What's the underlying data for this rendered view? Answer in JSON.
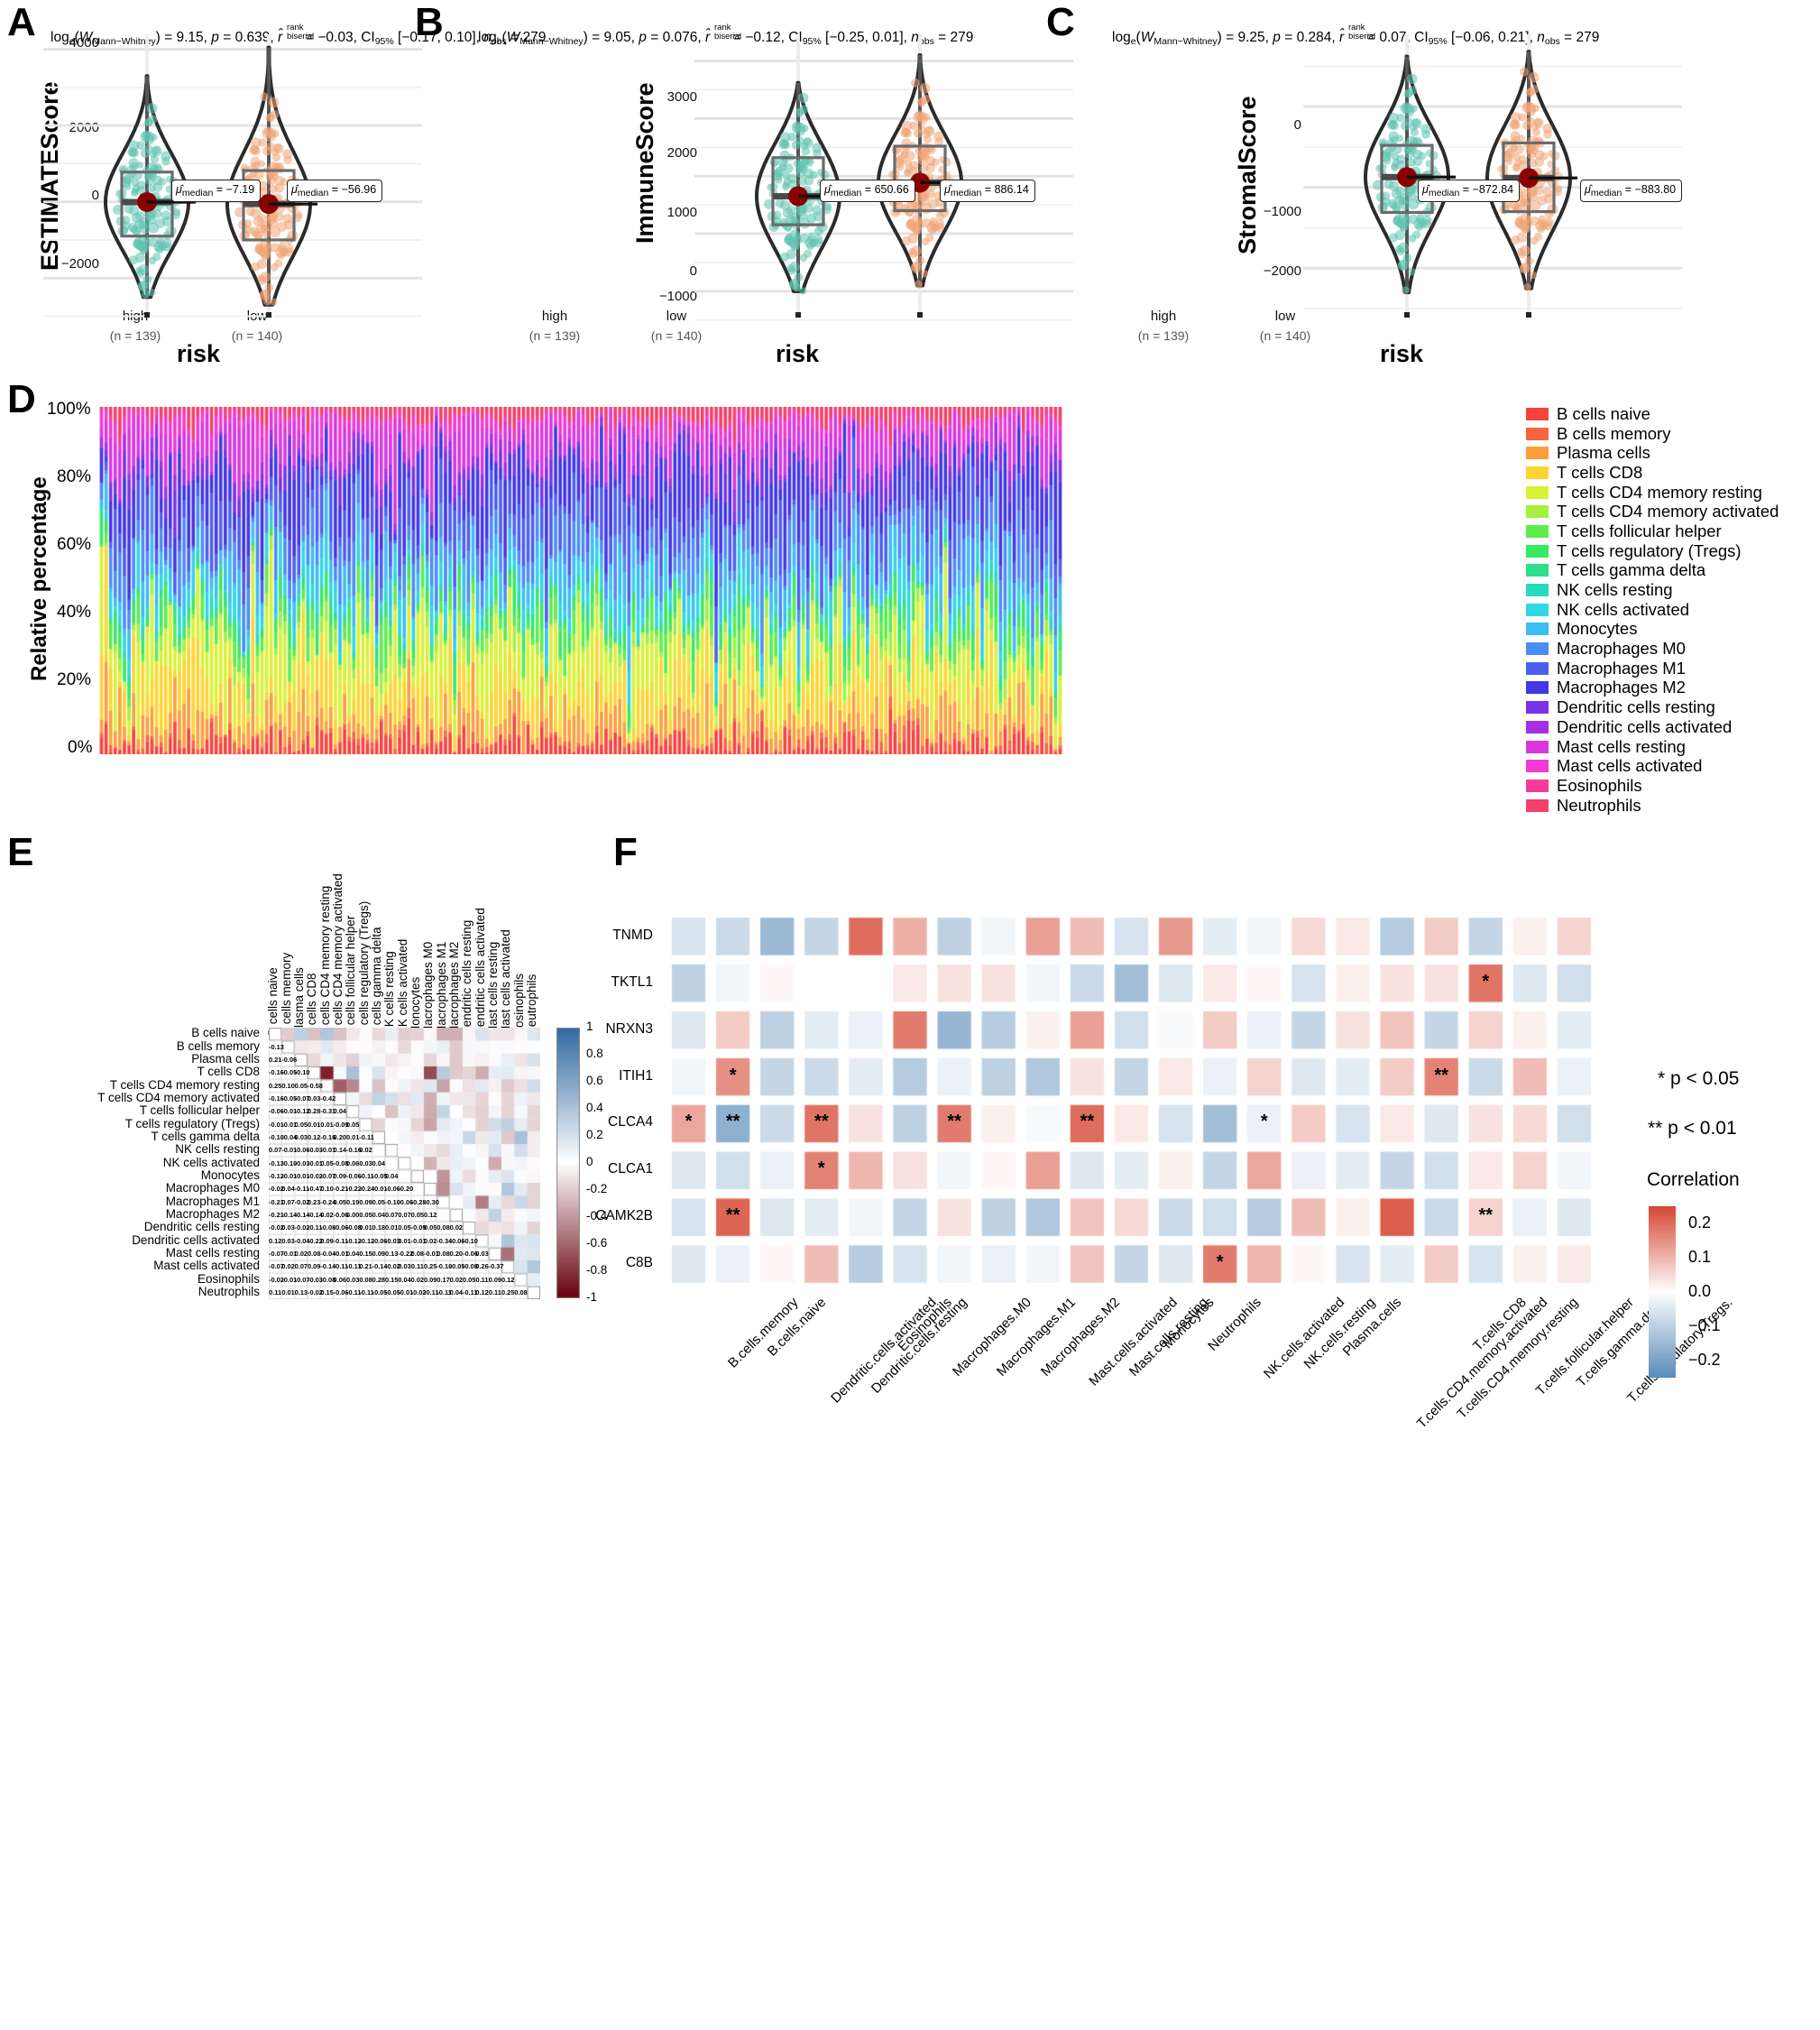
{
  "figure": {
    "panels": [
      "A",
      "B",
      "C",
      "D",
      "E",
      "F"
    ]
  },
  "panelA": {
    "letter": "A",
    "title_parts": {
      "logw": "log",
      "logw_sub": "e",
      "w": "W",
      "w_sub": "Mann−Whitney",
      "w_val": "= 9.15,",
      "p": "p",
      "p_val": "= 0.639,",
      "r_sup": "rank",
      "r_sub": "biserial",
      "r_val": "= −0.03,",
      "ci": "CI",
      "ci_sub": "95%",
      "ci_val": "[−0.17, 0.10],",
      "n": "n",
      "n_sub": "obs",
      "n_val": "= 279"
    },
    "ylabel": "ESTIMATEScore",
    "xlabel": "risk",
    "yticks": [
      "4000",
      "2000",
      "0",
      "−2000"
    ],
    "groups": [
      {
        "name": "high",
        "n": "(n = 139)",
        "median_label": "μ",
        "median_sub": "median",
        "median_val": "= −7.19"
      },
      {
        "name": "low",
        "n": "(n = 140)",
        "median_label": "μ",
        "median_sub": "median",
        "median_val": "= −56.96"
      }
    ]
  },
  "panelB": {
    "letter": "B",
    "title_parts": {
      "logw": "log",
      "logw_sub": "e",
      "w": "W",
      "w_sub": "Mann−Whitney",
      "w_val": "= 9.05,",
      "p": "p",
      "p_val": "= 0.076,",
      "r_sup": "rank",
      "r_sub": "biserial",
      "r_val": "= −0.12,",
      "ci": "CI",
      "ci_sub": "95%",
      "ci_val": "[−0.25, 0.01],",
      "n": "n",
      "n_sub": "obs",
      "n_val": "= 279"
    },
    "ylabel": "ImmuneScore",
    "xlabel": "risk",
    "yticks": [
      "3000",
      "2000",
      "1000",
      "0",
      "−1000"
    ],
    "groups": [
      {
        "name": "high",
        "n": "(n = 139)",
        "median_label": "μ",
        "median_sub": "median",
        "median_val": "= 650.66"
      },
      {
        "name": "low",
        "n": "(n = 140)",
        "median_label": "μ",
        "median_sub": "median",
        "median_val": "= 886.14"
      }
    ]
  },
  "panelC": {
    "letter": "C",
    "title_parts": {
      "logw": "log",
      "logw_sub": "e",
      "w": "W",
      "w_sub": "Mann−Whitney",
      "w_val": "= 9.25,",
      "p": "p",
      "p_val": "= 0.284,",
      "r_sup": "rank",
      "r_sub": "biserial",
      "r_val": "= 0.07,",
      "ci": "CI",
      "ci_sub": "95%",
      "ci_val": "[−0.06, 0.21],",
      "n": "n",
      "n_sub": "obs",
      "n_val": "= 279"
    },
    "ylabel": "StromalScore",
    "xlabel": "risk",
    "yticks": [
      "0",
      "−1000",
      "−2000"
    ],
    "groups": [
      {
        "name": "high",
        "n": "(n = 139)",
        "median_label": "μ",
        "median_sub": "median",
        "median_val": "= −872.84"
      },
      {
        "name": "low",
        "n": "(n = 140)",
        "median_label": "μ",
        "median_sub": "median",
        "median_val": "= −883.80"
      }
    ]
  },
  "panelD": {
    "letter": "D",
    "ylabel": "Relative percentage",
    "yticks": [
      "100%",
      "80%",
      "60%",
      "40%",
      "20%",
      "0%"
    ],
    "legend": [
      {
        "label": "B cells naive",
        "color": "#f8423c"
      },
      {
        "label": "B cells memory",
        "color": "#f9653f"
      },
      {
        "label": "Plasma cells",
        "color": "#fb9f3b"
      },
      {
        "label": "T cells CD8",
        "color": "#fdd431"
      },
      {
        "label": "T cells CD4 memory resting",
        "color": "#d9f135"
      },
      {
        "label": "T cells CD4 memory activated",
        "color": "#a3f03f"
      },
      {
        "label": "T cells follicular helper",
        "color": "#5ced4b"
      },
      {
        "label": "T cells regulatory (Tregs)",
        "color": "#39e95f"
      },
      {
        "label": "T cells gamma delta",
        "color": "#2de08b"
      },
      {
        "label": "NK cells resting",
        "color": "#27dbbd"
      },
      {
        "label": "NK cells activated",
        "color": "#2fd7e4"
      },
      {
        "label": "Monocytes",
        "color": "#3bbdf5"
      },
      {
        "label": "Macrophages M0",
        "color": "#4a8df5"
      },
      {
        "label": "Macrophages M1",
        "color": "#4c5ff0"
      },
      {
        "label": "Macrophages M2",
        "color": "#4236e6"
      },
      {
        "label": "Dendritic cells resting",
        "color": "#7a32e4"
      },
      {
        "label": "Dendritic cells activated",
        "color": "#a52fe2"
      },
      {
        "label": "Mast cells resting",
        "color": "#d936e0"
      },
      {
        "label": "Mast cells activated",
        "color": "#f23bd2"
      },
      {
        "label": "Eosinophils",
        "color": "#f63b9a"
      },
      {
        "label": "Neutrophils",
        "color": "#f4406a"
      }
    ]
  },
  "panelE": {
    "letter": "E",
    "labels": [
      "B cells naive",
      "B cells memory",
      "Plasma cells",
      "T cells CD8",
      "T cells CD4 memory resting",
      "T cells CD4 memory activated",
      "T cells follicular helper",
      "T cells regulatory (Tregs)",
      "T cells gamma delta",
      "NK cells resting",
      "NK cells activated",
      "Monocytes",
      "Macrophages M0",
      "Macrophages M1",
      "Macrophages M2",
      "Dendritic cells resting",
      "Dendritic cells activated",
      "Mast cells resting",
      "Mast cells activated",
      "Eosinophils",
      "Neutrophils"
    ],
    "scale_ticks": [
      "1",
      "0.8",
      "0.6",
      "0.4",
      "0.2",
      "0",
      "-0.2",
      "-0.4",
      "-0.6",
      "-0.8",
      "-1"
    ],
    "matrix": [
      [],
      [
        "-0.13"
      ],
      [
        "0.21",
        "-0.06"
      ],
      [
        "-0.16",
        "-0.05",
        "-0.10"
      ],
      [
        "0.25",
        "0.10",
        "0.05",
        "-0.58"
      ],
      [
        "-0.16",
        "-0.05",
        "-0.07",
        "0.03",
        "-0.42"
      ],
      [
        "-0.06",
        "-0.01",
        "-0.12",
        "0.28",
        "-0.31",
        "0.04"
      ],
      [
        "-0.01",
        "-0.01",
        "0.05",
        "0.01",
        "0.01",
        "-0.09",
        "0.05"
      ],
      [
        "-0.10",
        "-0.04",
        "0.03",
        "0.12",
        "-0.16",
        "0.20",
        "0.01",
        "-0.11"
      ],
      [
        "0.07",
        "-0.01",
        "-0.06",
        "-0.03",
        "-0.01",
        "0.14",
        "-0.16",
        "0.02"
      ],
      [
        "-0.13",
        "-0.10",
        "-0.03",
        "-0.01",
        "0.05",
        "-0.08",
        "0.06",
        "0.03",
        "0.04"
      ],
      [
        "-0.12",
        "-0.01",
        "-0.01",
        "-0.02",
        "-0.07",
        "0.09",
        "-0.06",
        "-0.11",
        "-0.05",
        "0.04"
      ],
      [
        "-0.02",
        "0.04",
        "-0.11",
        "-0.47",
        "0.10",
        "-0.21",
        "-0.22",
        "-0.24",
        "-0.01",
        "-0.06",
        "-0.20"
      ],
      [
        "-0.21",
        "0.07",
        "-0.02",
        "0.23",
        "-0.24",
        "0.05",
        "0.19",
        "0.09",
        "0.05",
        "-0.10",
        "-0.06",
        "-0.28",
        "-0.30"
      ],
      [
        "-0.21",
        "-0.14",
        "-0.14",
        "-0.14",
        "0.02",
        "-0.06",
        "0.00",
        "0.05",
        "0.04",
        "0.07",
        "0.07",
        "0.05",
        "0.12"
      ],
      [
        "-0.02",
        "0.03",
        "-0.02",
        "-0.11",
        "-0.08",
        "-0.06",
        "-0.08",
        "0.01",
        "0.18",
        "0.01",
        "0.05",
        "-0.09",
        "0.05",
        "0.08",
        "0.02"
      ],
      [
        "0.12",
        "0.03",
        "-0.04",
        "-0.22",
        "0.09",
        "-0.11",
        "-0.12",
        "-0.12",
        "-0.06",
        "-0.03",
        "0.01",
        "-0.01",
        "0.02",
        "-0.34",
        "-0.06",
        "-0.10"
      ],
      [
        "-0.07",
        "-0.01",
        "0.02",
        "0.08",
        "-0.04",
        "-0.01",
        "0.04",
        "0.15",
        "0.09",
        "0.13",
        "-0.22",
        "0.08",
        "-0.01",
        "0.08",
        "0.20",
        "-0.06",
        "0.03"
      ],
      [
        "-0.07",
        "0.02",
        "0.07",
        "0.09",
        "-0.14",
        "-0.11",
        "-0.11",
        "0.21",
        "-0.14",
        "-0.02",
        "0.03",
        "0.11",
        "0.25",
        "-0.10",
        "-0.05",
        "-0.08",
        "0.26",
        "-0.37"
      ],
      [
        "-0.02",
        "-0.01",
        "-0.07",
        "-0.03",
        "-0.08",
        "0.06",
        "0.03",
        "0.08",
        "0.28",
        "0.15",
        "0.04",
        "0.02",
        "0.09",
        "0.17",
        "0.02",
        "0.05",
        "0.11",
        "0.09",
        "0.12"
      ],
      [
        "0.11",
        "0.01",
        "0.13",
        "-0.02",
        "0.15",
        "-0.06",
        "-0.11",
        "-0.11",
        "-0.05",
        "-0.05",
        "-0.01",
        "-0.02",
        "-0.11",
        "-0.11",
        "0.04",
        "-0.11",
        "0.12",
        "0.11",
        "0.25",
        "0.08"
      ]
    ]
  },
  "panelF": {
    "letter": "F",
    "genes": [
      "TNMD",
      "TKTL1",
      "NRXN3",
      "ITIH1",
      "CLCA4",
      "CLCA1",
      "CAMK2B",
      "C8B"
    ],
    "cells": [
      "B.cells.memory",
      "B.cells.naive",
      "Dendritic.cells.activated",
      "Dendritic.cells.resting",
      "Eosinophils",
      "Macrophages.M0",
      "Macrophages.M1",
      "Macrophages.M2",
      "Mast.cells.activated",
      "Mast.cells.resting",
      "Monocytes",
      "Neutrophils",
      "NK.cells.activated",
      "NK.cells.resting",
      "Plasma.cells",
      "T.cells.CD4.memory.activated",
      "T.cells.CD4.memory.resting",
      "T.cells.CD8",
      "T.cells.follicular.helper",
      "T.cells.gamma.delta",
      "T.cells.regulatory.Tregs."
    ],
    "legend": {
      "p05": "* p < 0.05",
      "p01": "** p < 0.01",
      "scale_title": "Correlation",
      "scale_ticks": [
        "0.2",
        "0.1",
        "0.0",
        "−0.1",
        "−0.2"
      ]
    },
    "values": [
      [
        -0.06,
        -0.08,
        -0.15,
        -0.09,
        0.2,
        0.11,
        -0.1,
        -0.02,
        0.13,
        0.09,
        -0.06,
        0.14,
        -0.04,
        -0.02,
        0.05,
        0.03,
        -0.11,
        0.07,
        -0.09,
        0.02,
        0.06
      ],
      [
        -0.1,
        -0.02,
        0.01,
        0.0,
        0.0,
        0.03,
        0.04,
        0.04,
        -0.02,
        -0.08,
        -0.14,
        -0.05,
        0.03,
        0.01,
        -0.06,
        0.02,
        0.04,
        0.04,
        0.19,
        -0.05,
        -0.07
      ],
      [
        -0.05,
        0.07,
        -0.1,
        -0.04,
        -0.03,
        0.18,
        -0.16,
        -0.11,
        0.02,
        0.13,
        -0.07,
        -0.01,
        0.07,
        -0.03,
        -0.09,
        0.04,
        0.08,
        -0.09,
        0.06,
        0.02,
        -0.04
      ],
      [
        -0.02,
        0.15,
        -0.09,
        -0.08,
        -0.04,
        -0.11,
        -0.03,
        -0.1,
        -0.12,
        0.04,
        -0.09,
        0.03,
        -0.03,
        0.06,
        -0.05,
        -0.04,
        0.07,
        0.17,
        -0.08,
        0.09,
        -0.03
      ],
      [
        0.12,
        -0.17,
        -0.08,
        0.19,
        0.04,
        -0.1,
        0.18,
        0.02,
        -0.01,
        0.2,
        0.03,
        -0.06,
        -0.14,
        -0.03,
        0.07,
        -0.06,
        0.03,
        -0.05,
        0.04,
        0.05,
        -0.07
      ],
      [
        -0.05,
        -0.07,
        -0.03,
        0.17,
        0.1,
        0.04,
        -0.02,
        0.01,
        0.13,
        -0.05,
        -0.04,
        0.02,
        -0.09,
        0.12,
        -0.03,
        -0.04,
        -0.09,
        -0.07,
        0.03,
        0.06,
        -0.02
      ],
      [
        -0.06,
        0.21,
        -0.05,
        -0.04,
        -0.02,
        -0.09,
        0.04,
        -0.1,
        -0.12,
        0.08,
        0.05,
        -0.08,
        -0.07,
        -0.11,
        0.09,
        0.02,
        0.22,
        -0.08,
        0.06,
        -0.03,
        -0.05
      ],
      [
        -0.05,
        -0.03,
        0.01,
        0.09,
        -0.11,
        -0.06,
        -0.02,
        -0.03,
        -0.02,
        0.08,
        -0.09,
        -0.05,
        0.18,
        0.1,
        0.01,
        -0.06,
        -0.04,
        0.07,
        -0.06,
        0.02,
        0.03
      ]
    ],
    "stars": [
      {
        "gene": "TKTL1",
        "cell": "T.cells.follicular.helper",
        "mark": "*"
      },
      {
        "gene": "ITIH1",
        "cell": "B.cells.naive",
        "mark": "*"
      },
      {
        "gene": "ITIH1",
        "cell": "T.cells.CD8",
        "mark": "**"
      },
      {
        "gene": "CLCA4",
        "cell": "B.cells.memory",
        "mark": "*"
      },
      {
        "gene": "CLCA4",
        "cell": "B.cells.naive",
        "mark": "**"
      },
      {
        "gene": "CLCA4",
        "cell": "Dendritic.cells.resting",
        "mark": "**"
      },
      {
        "gene": "CLCA4",
        "cell": "Macrophages.M1",
        "mark": "**"
      },
      {
        "gene": "CLCA4",
        "cell": "Mast.cells.resting",
        "mark": "**"
      },
      {
        "gene": "CLCA4",
        "cell": "NK.cells.resting",
        "mark": "*"
      },
      {
        "gene": "CLCA1",
        "cell": "Dendritic.cells.resting",
        "mark": "*"
      },
      {
        "gene": "CAMK2B",
        "cell": "B.cells.naive",
        "mark": "**"
      },
      {
        "gene": "CAMK2B",
        "cell": "T.cells.follicular.helper",
        "mark": "**"
      },
      {
        "gene": "C8B",
        "cell": "NK.cells.activated",
        "mark": "*"
      }
    ]
  },
  "chart_data": [
    {
      "type": "violin",
      "panel": "A",
      "title": "log_e(W_Mann-Whitney) = 9.15, p = 0.639, r_rank_biserial = -0.03, CI95% [-0.17, 0.10], n_obs = 279",
      "ylabel": "ESTIMATEScore",
      "xlabel": "risk",
      "ylim": [
        -2800,
        4300
      ],
      "yticks": [
        4000,
        2000,
        0,
        -2000
      ],
      "groups": [
        {
          "name": "high",
          "n": 139,
          "median": -7.19,
          "q1": -900,
          "q3": 780,
          "min": -2500,
          "max": 3300
        },
        {
          "name": "low",
          "n": 140,
          "median": -56.96,
          "q1": -1000,
          "q3": 820,
          "min": -2700,
          "max": 4050
        }
      ]
    },
    {
      "type": "violin",
      "panel": "B",
      "title": "log_e(W_Mann-Whitney) = 9.05, p = 0.076, r_rank_biserial = -0.12, CI95% [-0.25, 0.01], n_obs = 279",
      "ylabel": "ImmuneScore",
      "xlabel": "risk",
      "ylim": [
        -1300,
        3400
      ],
      "yticks": [
        3000,
        2000,
        1000,
        0,
        -1000
      ],
      "groups": [
        {
          "name": "high",
          "n": 139,
          "median": 650.66,
          "q1": 155,
          "q3": 1320,
          "min": -1000,
          "max": 2620
        },
        {
          "name": "low",
          "n": 140,
          "median": 886.14,
          "q1": 400,
          "q3": 1520,
          "min": -900,
          "max": 3100
        }
      ]
    },
    {
      "type": "violin",
      "panel": "C",
      "title": "log_e(W_Mann-Whitney) = 9.25, p = 0.284, r_rank_biserial = 0.07, CI95% [-0.06, 0.21], n_obs = 279",
      "ylabel": "StromalScore",
      "xlabel": "risk",
      "ylim": [
        -2500,
        850
      ],
      "yticks": [
        0,
        -1000,
        -2000
      ],
      "groups": [
        {
          "name": "high",
          "n": 139,
          "median": -872.84,
          "q1": -1310,
          "q3": -480,
          "min": -2300,
          "max": 620
        },
        {
          "name": "low",
          "n": 140,
          "median": -883.8,
          "q1": -1300,
          "q3": -450,
          "min": -2250,
          "max": 680
        }
      ]
    },
    {
      "type": "bar",
      "panel": "D",
      "stacked": true,
      "title": "",
      "ylabel": "Relative percentage",
      "xlabel": "",
      "ylim": [
        0,
        100
      ],
      "yticks": [
        0,
        20,
        40,
        60,
        80,
        100
      ],
      "n_samples": 279,
      "series": [
        {
          "name": "B cells naive",
          "color": "#f8423c",
          "mean_pct": 3.2
        },
        {
          "name": "B cells memory",
          "color": "#f9653f",
          "mean_pct": 1.1
        },
        {
          "name": "Plasma cells",
          "color": "#fb9f3b",
          "mean_pct": 5.5
        },
        {
          "name": "T cells CD8",
          "color": "#fdd431",
          "mean_pct": 9.0
        },
        {
          "name": "T cells CD4 memory resting",
          "color": "#d9f135",
          "mean_pct": 10.5
        },
        {
          "name": "T cells CD4 memory activated",
          "color": "#a3f03f",
          "mean_pct": 2.0
        },
        {
          "name": "T cells follicular helper",
          "color": "#5ced4b",
          "mean_pct": 4.2
        },
        {
          "name": "T cells regulatory (Tregs)",
          "color": "#39e95f",
          "mean_pct": 3.0
        },
        {
          "name": "T cells gamma delta",
          "color": "#2de08b",
          "mean_pct": 1.0
        },
        {
          "name": "NK cells resting",
          "color": "#27dbbd",
          "mean_pct": 1.2
        },
        {
          "name": "NK cells activated",
          "color": "#2fd7e4",
          "mean_pct": 4.0
        },
        {
          "name": "Monocytes",
          "color": "#3bbdf5",
          "mean_pct": 5.5
        },
        {
          "name": "Macrophages M0",
          "color": "#4a8df5",
          "mean_pct": 7.5
        },
        {
          "name": "Macrophages M1",
          "color": "#4c5ff0",
          "mean_pct": 8.0
        },
        {
          "name": "Macrophages M2",
          "color": "#4236e6",
          "mean_pct": 12.0
        },
        {
          "name": "Dendritic cells resting",
          "color": "#7a32e4",
          "mean_pct": 3.5
        },
        {
          "name": "Dendritic cells activated",
          "color": "#a52fe2",
          "mean_pct": 2.0
        },
        {
          "name": "Mast cells resting",
          "color": "#d936e0",
          "mean_pct": 7.0
        },
        {
          "name": "Mast cells activated",
          "color": "#f23bd2",
          "mean_pct": 2.5
        },
        {
          "name": "Eosinophils",
          "color": "#f63b9a",
          "mean_pct": 0.8
        },
        {
          "name": "Neutrophils",
          "color": "#f4406a",
          "mean_pct": 2.5
        }
      ]
    },
    {
      "type": "heatmap",
      "panel": "E",
      "title": "",
      "xlabel": "",
      "ylabel": "",
      "colorbar": [
        -1,
        1
      ],
      "note": "Lower-triangular correlation matrix of 21 immune cell types"
    },
    {
      "type": "heatmap",
      "panel": "F",
      "title": "",
      "xlabel": "",
      "ylabel": "",
      "colorbar": [
        -0.2,
        0.2
      ],
      "note": "Gene vs immune cell correlation with significance stars"
    }
  ]
}
